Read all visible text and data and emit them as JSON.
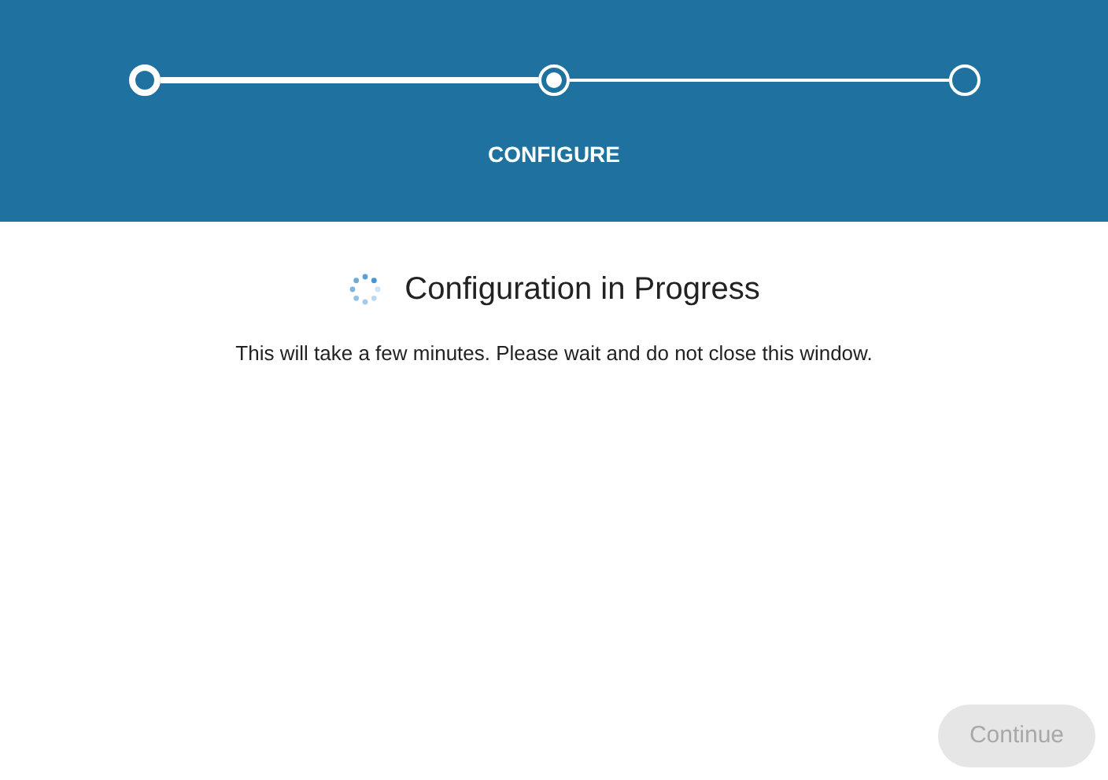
{
  "stepper": {
    "steps": [
      {
        "completed": true,
        "selected": false
      },
      {
        "completed": false,
        "selected": true,
        "label": "CONFIGURE"
      },
      {
        "completed": false,
        "selected": false
      }
    ]
  },
  "title": "Configuration in Progress",
  "message": "This will take a few minutes. Please wait and do not close this window.",
  "continue_button": {
    "label": "Continue",
    "disabled": true
  }
}
